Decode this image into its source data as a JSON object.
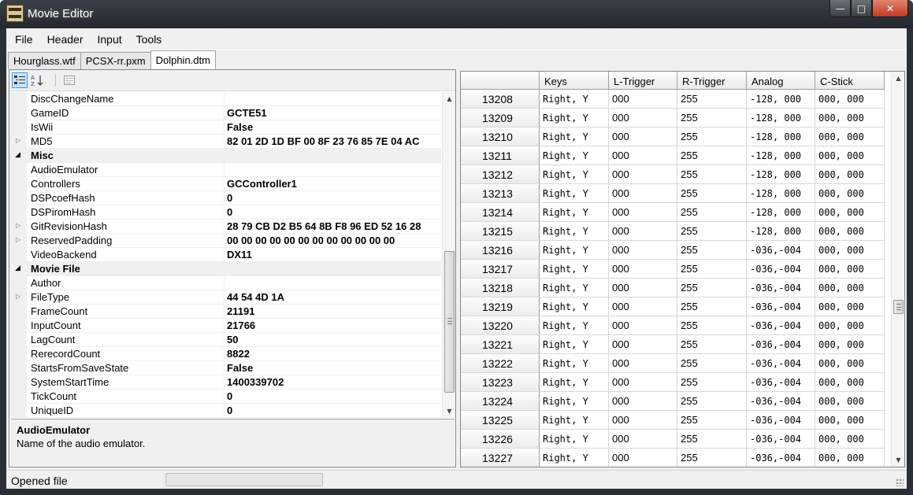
{
  "window": {
    "title": "Movie Editor"
  },
  "menu": [
    "File",
    "Header",
    "Input",
    "Tools"
  ],
  "tabs": [
    {
      "label": "Hourglass.wtf",
      "active": false
    },
    {
      "label": "PCSX-rr.pxm",
      "active": false
    },
    {
      "label": "Dolphin.dtm",
      "active": true
    }
  ],
  "toolbar": {
    "categorized_icon": "categorized-icon",
    "alphabetical_icon": "alphabetical-icon",
    "property_pages_icon": "property-pages-icon"
  },
  "properties": [
    {
      "name": "DiscChangeName",
      "value": ""
    },
    {
      "name": "GameID",
      "value": "GCTE51"
    },
    {
      "name": "IsWii",
      "value": "False"
    },
    {
      "name": "MD5",
      "value": "82 01 2D 1D BF 00 8F 23 76 85 7E 04 AC",
      "expandable": true
    },
    {
      "name": "Misc",
      "category": true
    },
    {
      "name": "AudioEmulator",
      "value": "",
      "selected": true
    },
    {
      "name": "Controllers",
      "value": "GCController1"
    },
    {
      "name": "DSPcoefHash",
      "value": "0"
    },
    {
      "name": "DSPiromHash",
      "value": "0"
    },
    {
      "name": "GitRevisionHash",
      "value": "28 79 CB D2 B5 64 8B F8 96 ED 52 16 28",
      "expandable": true
    },
    {
      "name": "ReservedPadding",
      "value": "00 00 00 00 00 00 00 00 00 00 00 00",
      "expandable": true
    },
    {
      "name": "VideoBackend",
      "value": "DX11"
    },
    {
      "name": "Movie File",
      "category": true
    },
    {
      "name": "Author",
      "value": ""
    },
    {
      "name": "FileType",
      "value": "44 54 4D 1A",
      "expandable": true
    },
    {
      "name": "FrameCount",
      "value": "21191"
    },
    {
      "name": "InputCount",
      "value": "21766"
    },
    {
      "name": "LagCount",
      "value": "50"
    },
    {
      "name": "RerecordCount",
      "value": "8822"
    },
    {
      "name": "StartsFromSaveState",
      "value": "False"
    },
    {
      "name": "SystemStartTime",
      "value": "1400339702"
    },
    {
      "name": "TickCount",
      "value": "0"
    },
    {
      "name": "UniqueID",
      "value": "0"
    }
  ],
  "help": {
    "title": "AudioEmulator",
    "description": "Name of the audio emulator."
  },
  "grid": {
    "columns": [
      "",
      "Keys",
      "L-Trigger",
      "R-Trigger",
      "Analog",
      "C-Stick"
    ],
    "rows": [
      [
        "13208",
        "Right, Y",
        "000",
        "255",
        "-128, 000",
        "000, 000"
      ],
      [
        "13209",
        "Right, Y",
        "000",
        "255",
        "-128, 000",
        "000, 000"
      ],
      [
        "13210",
        "Right, Y",
        "000",
        "255",
        "-128, 000",
        "000, 000"
      ],
      [
        "13211",
        "Right, Y",
        "000",
        "255",
        "-128, 000",
        "000, 000"
      ],
      [
        "13212",
        "Right, Y",
        "000",
        "255",
        "-128, 000",
        "000, 000"
      ],
      [
        "13213",
        "Right, Y",
        "000",
        "255",
        "-128, 000",
        "000, 000"
      ],
      [
        "13214",
        "Right, Y",
        "000",
        "255",
        "-128, 000",
        "000, 000"
      ],
      [
        "13215",
        "Right, Y",
        "000",
        "255",
        "-128, 000",
        "000, 000"
      ],
      [
        "13216",
        "Right, Y",
        "000",
        "255",
        "-036,-004",
        "000, 000"
      ],
      [
        "13217",
        "Right, Y",
        "000",
        "255",
        "-036,-004",
        "000, 000"
      ],
      [
        "13218",
        "Right, Y",
        "000",
        "255",
        "-036,-004",
        "000, 000"
      ],
      [
        "13219",
        "Right, Y",
        "000",
        "255",
        "-036,-004",
        "000, 000"
      ],
      [
        "13220",
        "Right, Y",
        "000",
        "255",
        "-036,-004",
        "000, 000"
      ],
      [
        "13221",
        "Right, Y",
        "000",
        "255",
        "-036,-004",
        "000, 000"
      ],
      [
        "13222",
        "Right, Y",
        "000",
        "255",
        "-036,-004",
        "000, 000"
      ],
      [
        "13223",
        "Right, Y",
        "000",
        "255",
        "-036,-004",
        "000, 000"
      ],
      [
        "13224",
        "Right, Y",
        "000",
        "255",
        "-036,-004",
        "000, 000"
      ],
      [
        "13225",
        "Right, Y",
        "000",
        "255",
        "-036,-004",
        "000, 000"
      ],
      [
        "13226",
        "Right, Y",
        "000",
        "255",
        "-036,-004",
        "000, 000"
      ],
      [
        "13227",
        "Right, Y",
        "000",
        "255",
        "-036,-004",
        "000, 000"
      ]
    ]
  },
  "status": {
    "text": "Opened file",
    "progress": 0
  }
}
